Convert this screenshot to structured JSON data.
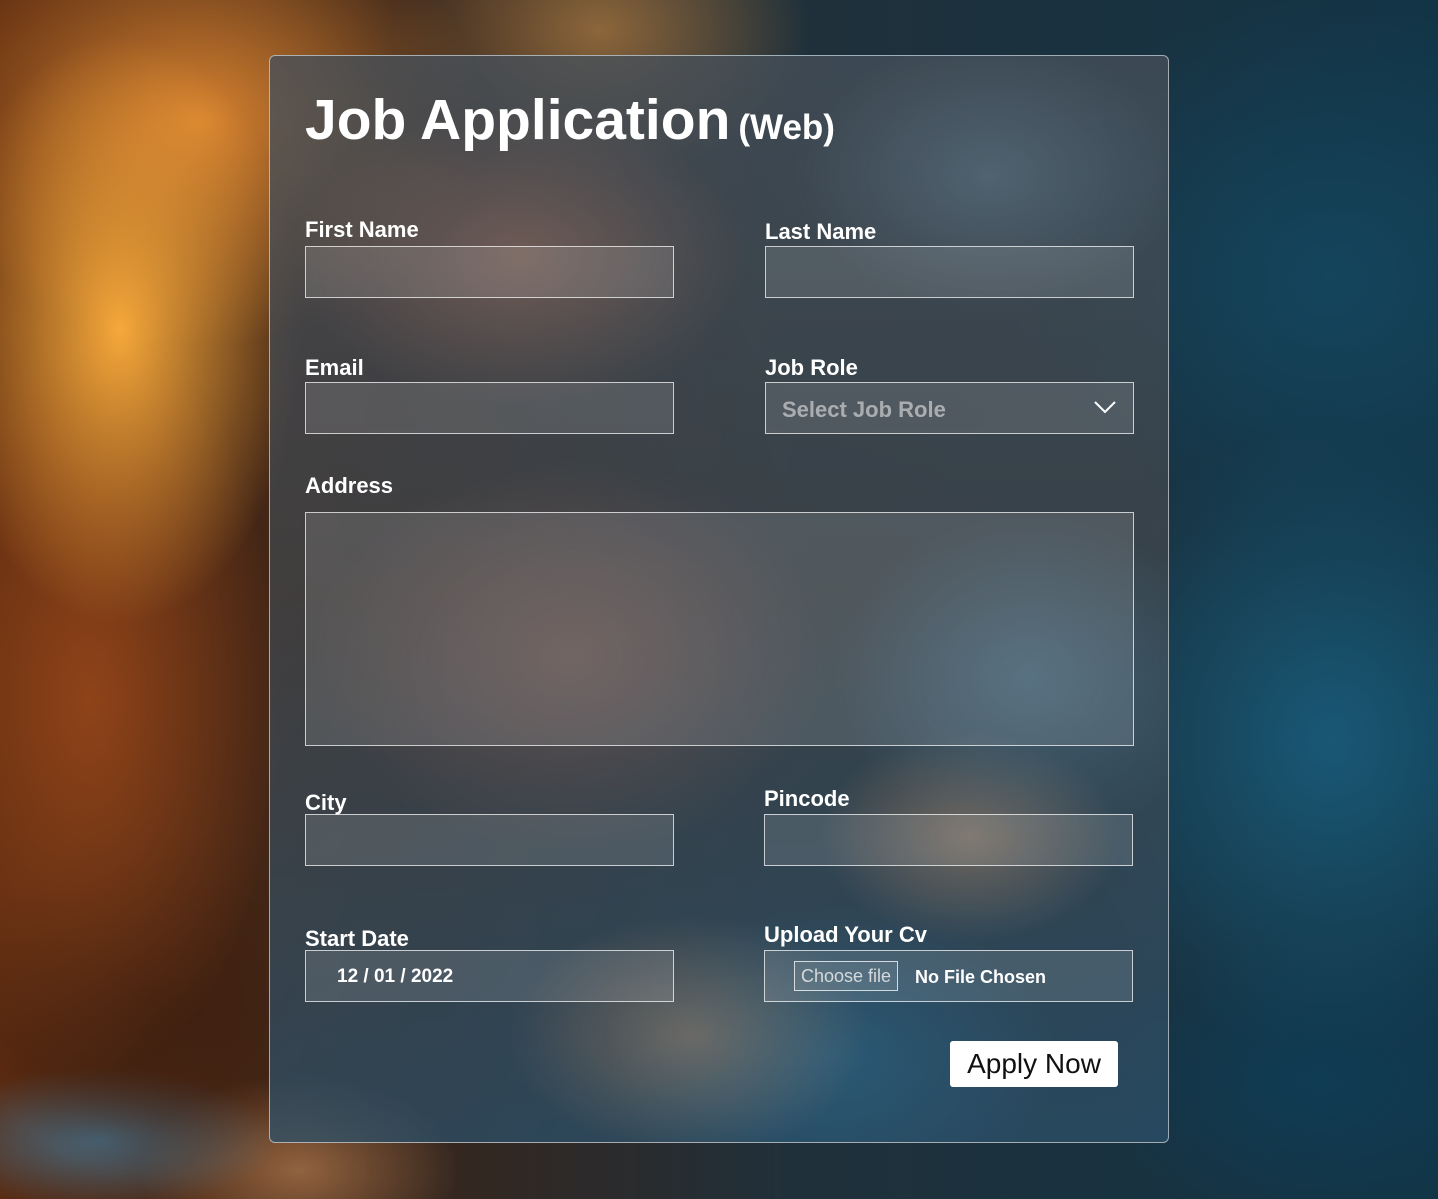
{
  "form": {
    "title": "Job Application",
    "title_suffix": "(Web)",
    "first_name": {
      "label": "First Name",
      "value": ""
    },
    "last_name": {
      "label": "Last Name",
      "value": ""
    },
    "email": {
      "label": "Email",
      "value": ""
    },
    "job_role": {
      "label": "Job Role",
      "placeholder": "Select Job Role",
      "icon": "chevron-down-icon"
    },
    "address": {
      "label": "Address",
      "value": ""
    },
    "city": {
      "label": "City",
      "value": ""
    },
    "pincode": {
      "label": "Pincode",
      "value": ""
    },
    "start_date": {
      "label": "Start Date",
      "value": "12 / 01 / 2022"
    },
    "cv_upload": {
      "label": "Upload Your Cv",
      "button_label": "Choose file",
      "status": "No File Chosen"
    },
    "submit_label": "Apply Now"
  },
  "colors": {
    "text": "#ffffff",
    "button_bg": "#ffffff",
    "button_text": "#111111",
    "border": "#ffffff"
  }
}
